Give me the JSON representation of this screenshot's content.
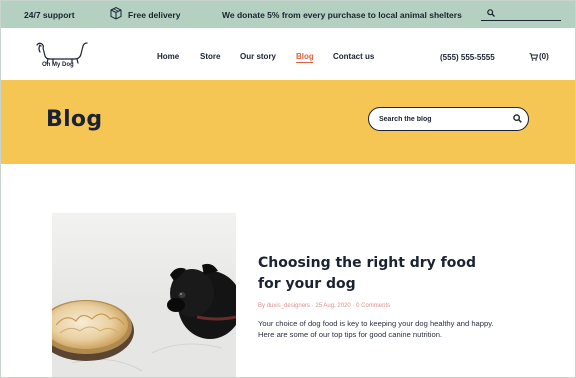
{
  "topbar": {
    "support": "24/7 support",
    "delivery": "Free delivery",
    "donate": "We donate 5% from every purchase to local animal shelters",
    "search_placeholder": ""
  },
  "header": {
    "logo_text": "Oh My Dog",
    "nav": {
      "home": "Home",
      "store": "Store",
      "story": "Our story",
      "blog": "Blog",
      "contact": "Contact us"
    },
    "active_nav": "Blog",
    "phone": "(555) 555-5555",
    "cart_count": "0"
  },
  "hero": {
    "title": "Blog",
    "search_placeholder": "Search the blog"
  },
  "post": {
    "title": "Choosing the right dry food for your dog",
    "meta_by": "By",
    "author": "duxis_designers",
    "date": "25 Aug, 2020",
    "comments": "0 Comments",
    "excerpt": "Your choice of dog food is key to keeping your dog healthy and happy. Here are some of our top tips for good canine nutrition."
  },
  "colors": {
    "topbar_bg": "#b3d0c1",
    "hero_bg": "#f6c655",
    "accent": "#e0613d",
    "text_dark": "#1b2232"
  }
}
